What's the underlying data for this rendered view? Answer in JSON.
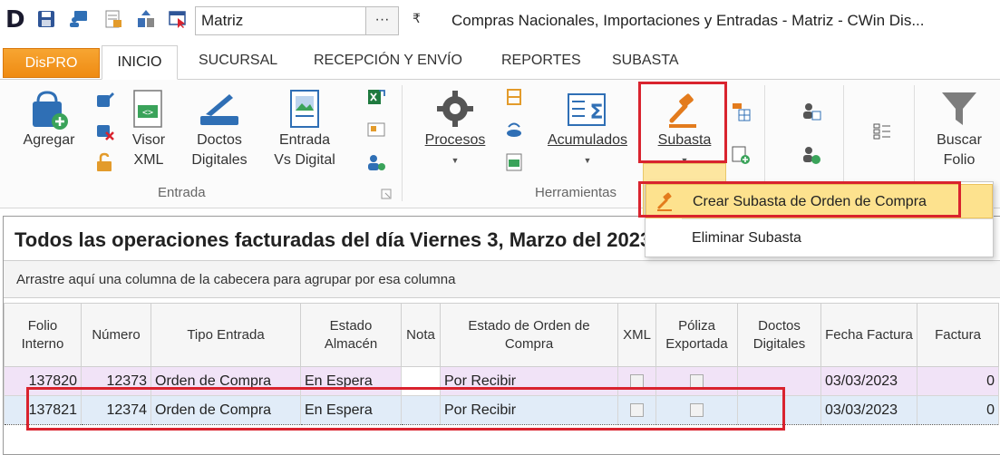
{
  "quick_access": {
    "combo_value": "Matriz",
    "combo_button": "···",
    "dropdown_glyph": "₹",
    "window_title": "Compras Nacionales, Importaciones y Entradas - Matriz - CWin Dis..."
  },
  "tabs": {
    "dispro": "DisPRO",
    "items": [
      "INICIO",
      "SUCURSAL",
      "RECEPCIÓN Y ENVÍO",
      "REPORTES",
      "SUBASTA"
    ]
  },
  "ribbon": {
    "agregar": "Agregar",
    "visor": [
      "Visor",
      "XML"
    ],
    "doctos": [
      "Doctos",
      "Digitales"
    ],
    "entrada_vs": [
      "Entrada",
      "Vs Digital"
    ],
    "procesos": "Procesos",
    "acumulados": "Acumulados",
    "subasta": "Subasta",
    "buscar": [
      "Buscar",
      "Folio"
    ],
    "group_entrada": "Entrada",
    "group_herramientas": "Herramientas"
  },
  "dropdown": {
    "items": [
      "Crear Subasta de Orden de Compra",
      "Eliminar Subasta"
    ]
  },
  "grid": {
    "title": "Todos las operaciones facturadas del día Viernes 3, Marzo del 2023",
    "group_hint": "Arrastre aquí una columna de la cabecera para agrupar por esa columna",
    "headers": [
      "Folio Interno",
      "Número",
      "Tipo Entrada",
      "Estado Almacén",
      "Nota",
      "Estado de Orden de Compra",
      "XML",
      "Póliza Exportada",
      "Doctos Digitales",
      "Fecha Factura",
      "Factura"
    ],
    "rows": [
      {
        "folio": "137820",
        "numero": "12373",
        "tipo": "Orden de Compra",
        "estado_almacen": "En Espera",
        "nota": "",
        "estado_oc": "Por Recibir",
        "fecha": "03/03/2023",
        "factura": "0"
      },
      {
        "folio": "137821",
        "numero": "12374",
        "tipo": "Orden de Compra",
        "estado_almacen": "En Espera",
        "nota": "",
        "estado_oc": "Por Recibir",
        "fecha": "03/03/2023",
        "factura": "0"
      }
    ]
  },
  "colors": {
    "accent_orange": "#ef8b13",
    "highlight_yellow": "#fde28e",
    "annotation_red": "#d9232e",
    "row_selected": "#e1ecf8",
    "row_alt": "#f1e3f7"
  }
}
